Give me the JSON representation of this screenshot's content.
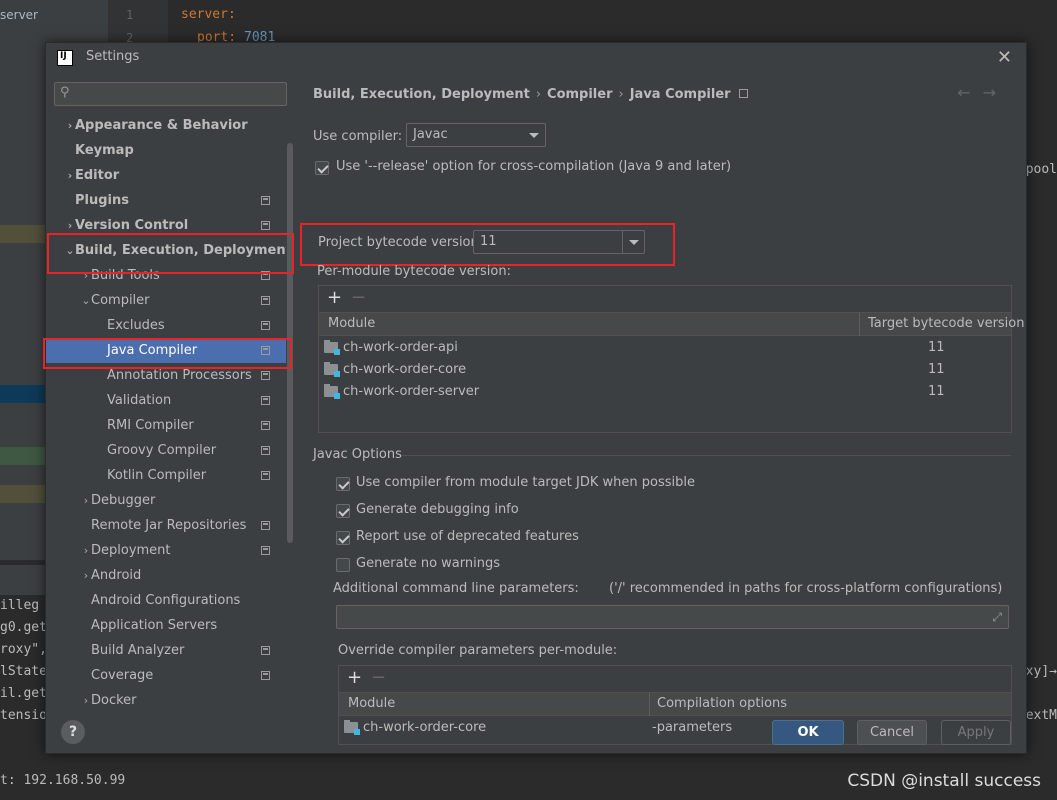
{
  "background": {
    "project_label": "server",
    "line_numbers": [
      "1",
      "2"
    ],
    "code_line1_key": "server:",
    "code_line2_key": "port:",
    "code_line2_value": "7081",
    "right_snippets": [
      "pool",
      "oxy]→",
      "extM"
    ],
    "console_lines": [
      "illeg",
      "g0.get",
      "roxy\",",
      "lState",
      "il.get",
      "tension"
    ],
    "console_bottom": "t: 192.168.50.99",
    "watermark": "CSDN @install success"
  },
  "dialog": {
    "title": "Settings",
    "search": {
      "placeholder": "",
      "value": ""
    },
    "tree": [
      {
        "label": "Appearance & Behavior",
        "bold": true,
        "chevron": "›",
        "level": 0,
        "proj": false
      },
      {
        "label": "Keymap",
        "bold": true,
        "chevron": "",
        "level": 0,
        "proj": false
      },
      {
        "label": "Editor",
        "bold": true,
        "chevron": "›",
        "level": 0,
        "proj": false
      },
      {
        "label": "Plugins",
        "bold": true,
        "chevron": "",
        "level": 0,
        "proj": true
      },
      {
        "label": "Version Control",
        "bold": true,
        "chevron": "›",
        "level": 0,
        "proj": true
      },
      {
        "label": "Build, Execution, Deployment",
        "bold": true,
        "chevron": "⌄",
        "level": 0,
        "proj": false
      },
      {
        "label": "Build Tools",
        "bold": false,
        "chevron": "›",
        "level": 1,
        "proj": true
      },
      {
        "label": "Compiler",
        "bold": false,
        "chevron": "⌄",
        "level": 1,
        "proj": true
      },
      {
        "label": "Excludes",
        "bold": false,
        "chevron": "",
        "level": 2,
        "proj": true
      },
      {
        "label": "Java Compiler",
        "bold": false,
        "chevron": "",
        "level": 2,
        "proj": true,
        "selected": true
      },
      {
        "label": "Annotation Processors",
        "bold": false,
        "chevron": "",
        "level": 2,
        "proj": true
      },
      {
        "label": "Validation",
        "bold": false,
        "chevron": "",
        "level": 2,
        "proj": true
      },
      {
        "label": "RMI Compiler",
        "bold": false,
        "chevron": "",
        "level": 2,
        "proj": true
      },
      {
        "label": "Groovy Compiler",
        "bold": false,
        "chevron": "",
        "level": 2,
        "proj": true
      },
      {
        "label": "Kotlin Compiler",
        "bold": false,
        "chevron": "",
        "level": 2,
        "proj": true
      },
      {
        "label": "Debugger",
        "bold": false,
        "chevron": "›",
        "level": 1,
        "proj": false
      },
      {
        "label": "Remote Jar Repositories",
        "bold": false,
        "chevron": "",
        "level": 1,
        "proj": true
      },
      {
        "label": "Deployment",
        "bold": false,
        "chevron": "›",
        "level": 1,
        "proj": true
      },
      {
        "label": "Android",
        "bold": false,
        "chevron": "›",
        "level": 1,
        "proj": false
      },
      {
        "label": "Android Configurations",
        "bold": false,
        "chevron": "",
        "level": 1,
        "proj": false
      },
      {
        "label": "Application Servers",
        "bold": false,
        "chevron": "",
        "level": 1,
        "proj": false
      },
      {
        "label": "Build Analyzer",
        "bold": false,
        "chevron": "",
        "level": 1,
        "proj": true
      },
      {
        "label": "Coverage",
        "bold": false,
        "chevron": "",
        "level": 1,
        "proj": true
      },
      {
        "label": "Docker",
        "bold": false,
        "chevron": "›",
        "level": 1,
        "proj": false
      }
    ],
    "breadcrumb": [
      "Build, Execution, Deployment",
      "Compiler",
      "Java Compiler"
    ],
    "breadcrumb_sep": "›",
    "nav": {
      "back": "←",
      "forward": "→"
    },
    "use_compiler": {
      "label": "Use compiler:",
      "value": "Javac"
    },
    "release_option": {
      "label": "Use '--release' option for cross-compilation (Java 9 and later)",
      "checked": true
    },
    "project_bytecode": {
      "label": "Project bytecode version:",
      "value": "11"
    },
    "per_module": {
      "label": "Per-module bytecode version:",
      "add": "+",
      "remove": "−",
      "columns": [
        "Module",
        "Target bytecode version"
      ],
      "rows": [
        {
          "module": "ch-work-order-api",
          "version": "11"
        },
        {
          "module": "ch-work-order-core",
          "version": "11"
        },
        {
          "module": "ch-work-order-server",
          "version": "11"
        }
      ]
    },
    "javac_options": {
      "title": "Javac Options",
      "checkboxes": [
        {
          "label": "Use compiler from module target JDK when possible",
          "checked": true
        },
        {
          "label": "Generate debugging info",
          "checked": true
        },
        {
          "label": "Report use of deprecated features",
          "checked": true
        },
        {
          "label": "Generate no warnings",
          "checked": false
        }
      ],
      "additional_label": "Additional command line parameters:",
      "additional_hint": "('/' recommended in paths for cross-platform configurations)",
      "additional_value": "",
      "override_label": "Override compiler parameters per-module:",
      "override_add": "+",
      "override_remove": "−",
      "override_columns": [
        "Module",
        "Compilation options"
      ],
      "override_rows": [
        {
          "module": "ch-work-order-core",
          "options": "-parameters"
        }
      ]
    },
    "buttons": {
      "help": "?",
      "ok": "OK",
      "cancel": "Cancel",
      "apply": "Apply"
    }
  },
  "colors": {
    "selection": "#4b6eaf",
    "highlight_box": "#e8232a",
    "ok_button": "#365880",
    "dialog_bg": "#3c3f41",
    "editor_bg": "#2b2b2b"
  }
}
